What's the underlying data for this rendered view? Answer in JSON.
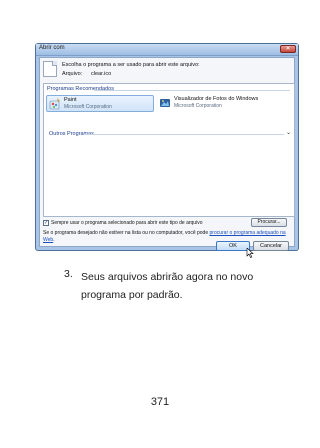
{
  "dialog": {
    "title": "Abrir com",
    "close_label": "✕",
    "prompt": "Escolha o programa a ser usado para abrir este arquivo:",
    "file_label": "Arquivo:",
    "file_name": "clear.ico",
    "recommended_header": "Programas Recomendados",
    "other_header": "Outros Programas",
    "programs": [
      {
        "name": "Paint",
        "vendor": "Microsoft Corporation",
        "icon": "paint-icon"
      },
      {
        "name": "Visualizador de Fotos do Windows",
        "vendor": "Microsoft Corporation",
        "icon": "photo-viewer-icon"
      }
    ],
    "always_use_checked": true,
    "always_use_label": "Sempre usar o programa selecionado para abrir este tipo de arquivo",
    "browse_label": "Procurar...",
    "hint_text": "Se o programa desejado não estiver na lista ou no computador, você pode ",
    "hint_link": "procurar o programa adequado na Web",
    "hint_end": ".",
    "ok_label": "OK",
    "cancel_label": "Cancelar"
  },
  "page": {
    "list_number": "3.",
    "list_text": "Seus arquivos abrirão agora no novo programa por padrão.",
    "page_number": "371"
  }
}
